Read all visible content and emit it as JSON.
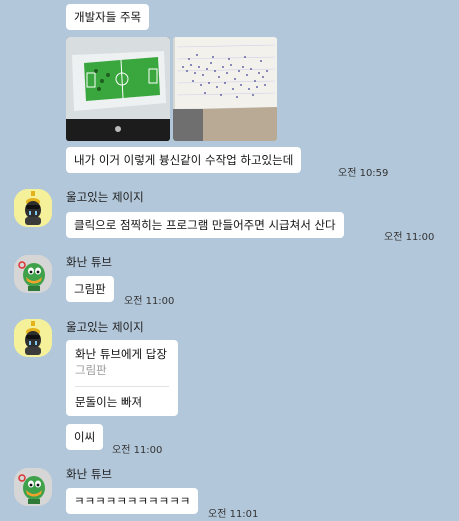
{
  "messages": {
    "m1": {
      "text": "개발자들 주목"
    },
    "m2": {
      "text": "내가 이거 이렇게 븅신같이 수작업 하고있는데",
      "time": "오전 10:59"
    },
    "sender_jeiji": {
      "name": "울고있는 제이지"
    },
    "m3": {
      "text": "클릭으로 점찍히는 프로그램 만들어주면 시급쳐서 산다",
      "time": "오전 11:00"
    },
    "sender_tube": {
      "name": "화난 튜브"
    },
    "m4": {
      "text": "그림판",
      "time": "오전 11:00"
    },
    "sender_jeiji2": {
      "name": "울고있는 제이지"
    },
    "m5": {
      "reply_to": "화난 튜브에게 답장",
      "quoted": "그림판",
      "text": "문돌이는 빠져"
    },
    "m6": {
      "text": "이씨",
      "time": "오전 11:00"
    },
    "sender_tube2": {
      "name": "화난 튜브"
    },
    "m7": {
      "text": "ㅋㅋㅋㅋㅋㅋㅋㅋㅋㅋㅋ",
      "time": "오전 11:01"
    }
  },
  "colors": {
    "background": "#b2c7da",
    "bubble": "#ffffff",
    "jeiji_avatar_bg": "#f4f19a",
    "tube_avatar_bg": "#d6d6d6"
  },
  "icons": {
    "jeiji_avatar": "jay-g-character-icon",
    "tube_avatar": "tube-duck-character-icon"
  }
}
